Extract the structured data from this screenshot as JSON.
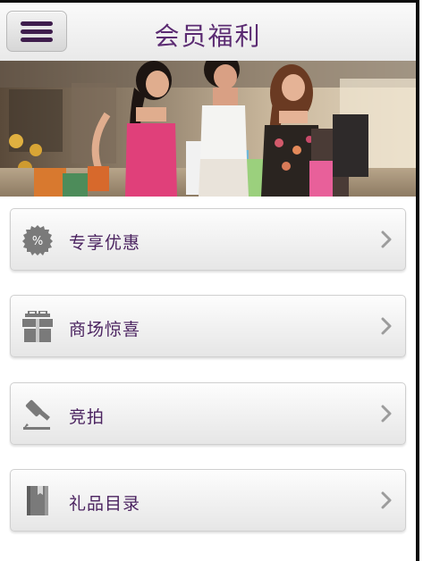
{
  "header": {
    "title": "会员福利",
    "menu_icon": "hamburger-menu-icon"
  },
  "banner": {
    "image_subject": "three women holding shopping bags in a mall"
  },
  "menu": {
    "items": [
      {
        "label": "专享优惠",
        "icon": "percent-badge-icon"
      },
      {
        "label": "商场惊喜",
        "icon": "gift-box-icon"
      },
      {
        "label": "竞拍",
        "icon": "auction-gavel-icon"
      },
      {
        "label": "礼品目录",
        "icon": "catalog-book-icon"
      }
    ],
    "chevron_icon": "chevron-right-icon"
  },
  "colors": {
    "brand_purple": "#5b2b72",
    "label_purple": "#4b2360",
    "icon_gray": "#7a7a7a"
  }
}
